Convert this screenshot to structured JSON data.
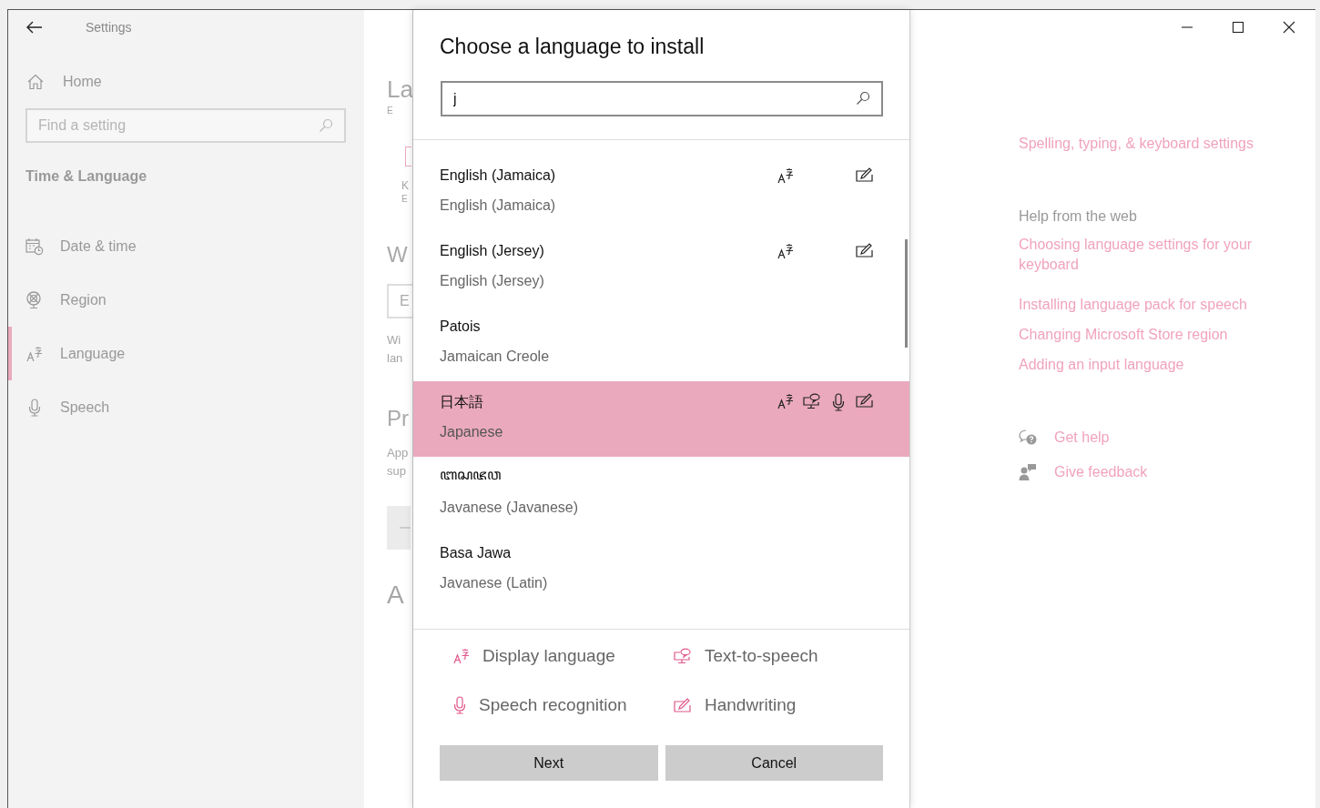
{
  "window": {
    "title": "Settings"
  },
  "sidebar": {
    "home": "Home",
    "search": {
      "placeholder": "Find a setting"
    },
    "section": "Time & Language",
    "items": [
      {
        "label": "Date & time",
        "selected": false
      },
      {
        "label": "Region",
        "selected": false
      },
      {
        "label": "Language",
        "selected": true
      },
      {
        "label": "Speech",
        "selected": false
      }
    ]
  },
  "background_page": {
    "title": "La",
    "line_1": "E",
    "line_2": "K",
    "line_3": "E",
    "section_1": "W",
    "field_1": "E",
    "note_1": [
      "Wi",
      "lan"
    ],
    "section_2": "Pr",
    "note_2": [
      "App",
      "sup"
    ],
    "icon_text": "A"
  },
  "dialog": {
    "title": "Choose a language to install",
    "search": {
      "value": "j"
    },
    "languages": [
      {
        "name": "English (Jamaica)",
        "subtitle": "English (Jamaica)",
        "selected": false,
        "display_language": true,
        "text_to_speech": false,
        "speech_recognition": false,
        "handwriting": true
      },
      {
        "name": "English (Jersey)",
        "subtitle": "English (Jersey)",
        "selected": false,
        "display_language": true,
        "text_to_speech": false,
        "speech_recognition": false,
        "handwriting": true
      },
      {
        "name": "Patois",
        "subtitle": "Jamaican Creole",
        "selected": false,
        "display_language": false,
        "text_to_speech": false,
        "speech_recognition": false,
        "handwriting": false
      },
      {
        "name": "日本語",
        "subtitle": "Japanese",
        "selected": true,
        "display_language": true,
        "text_to_speech": true,
        "speech_recognition": true,
        "handwriting": true
      },
      {
        "name": "ꦧꦱꦗꦮ",
        "subtitle": "Javanese (Javanese)",
        "selected": false,
        "display_language": false,
        "text_to_speech": false,
        "speech_recognition": false,
        "handwriting": false
      },
      {
        "name": "Basa Jawa",
        "subtitle": "Javanese (Latin)",
        "selected": false,
        "display_language": false,
        "text_to_speech": false,
        "speech_recognition": false,
        "handwriting": false
      }
    ],
    "legend": [
      "Display language",
      "Text-to-speech",
      "Speech recognition",
      "Handwriting"
    ],
    "buttons": [
      "Next",
      "Cancel"
    ]
  },
  "related": {
    "link": "Spelling, typing, & keyboard settings",
    "help_heading": "Help from the web",
    "help_links": [
      "Choosing language settings for your keyboard",
      "Installing language pack for speech",
      "Changing Microsoft Store region",
      "Adding an input language"
    ],
    "support": [
      "Get help",
      "Give feedback"
    ]
  }
}
